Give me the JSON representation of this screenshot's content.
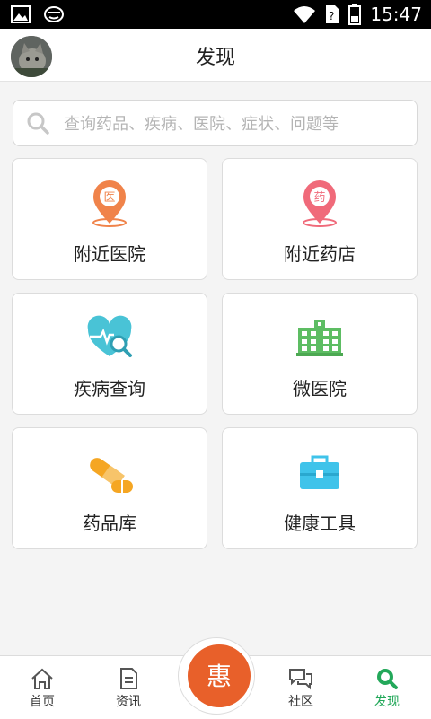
{
  "status_bar": {
    "time": "15:47",
    "icons": [
      "image-icon",
      "face-icon",
      "wifi-icon",
      "sim-unknown-icon",
      "battery-icon"
    ]
  },
  "header": {
    "title": "发现"
  },
  "search": {
    "placeholder": "查询药品、疾病、医院、症状、问题等"
  },
  "grid": {
    "items": [
      {
        "label": "附近医院",
        "icon": "hospital-location-icon",
        "badge": "医",
        "color": "#f0834a"
      },
      {
        "label": "附近药店",
        "icon": "pharmacy-location-icon",
        "badge": "药",
        "color": "#f06a7a"
      },
      {
        "label": "疾病查询",
        "icon": "heart-search-icon",
        "color": "#49c3d6"
      },
      {
        "label": "微医院",
        "icon": "building-icon",
        "color": "#5dbd63"
      },
      {
        "label": "药品库",
        "icon": "pill-capsule-icon",
        "color": "#f5a623"
      },
      {
        "label": "健康工具",
        "icon": "toolbox-icon",
        "color": "#3fc3ea"
      }
    ]
  },
  "bottom_nav": {
    "items": [
      {
        "label": "首页",
        "icon": "home-icon"
      },
      {
        "label": "资讯",
        "icon": "document-icon"
      },
      {
        "label": "社区",
        "icon": "chat-icon"
      },
      {
        "label": "发现",
        "icon": "search-icon",
        "active": true
      }
    ],
    "center_label": "惠",
    "active_color": "#23a85a",
    "center_color": "#e8602a"
  }
}
